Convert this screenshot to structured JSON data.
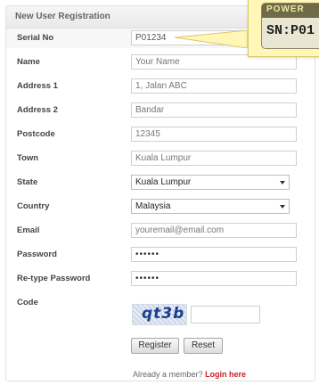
{
  "form": {
    "title": "New User Registration",
    "rows": [
      {
        "label": "Serial No",
        "value": "P01234"
      },
      {
        "label": "Name",
        "placeholder": "Your Name"
      },
      {
        "label": "Address 1",
        "placeholder": "1, Jalan ABC"
      },
      {
        "label": "Address 2",
        "placeholder": "Bandar"
      },
      {
        "label": "Postcode",
        "placeholder": "12345"
      },
      {
        "label": "Town",
        "placeholder": "Kuala Lumpur"
      },
      {
        "label": "State",
        "selected": "Kuala Lumpur"
      },
      {
        "label": "Country",
        "selected": "Malaysia"
      },
      {
        "label": "Email",
        "placeholder": "youremail@email.com"
      },
      {
        "label": "Password",
        "value": "••••••"
      },
      {
        "label": "Re-type Password",
        "value": "••••••"
      },
      {
        "label": "Code",
        "captcha": "qt3b"
      }
    ],
    "register_label": "Register",
    "reset_label": "Reset",
    "member_text": "Already a member?",
    "login_link": "Login here"
  },
  "tooltip": {
    "header_text": "POWER",
    "serial_text": "SN:P01"
  }
}
